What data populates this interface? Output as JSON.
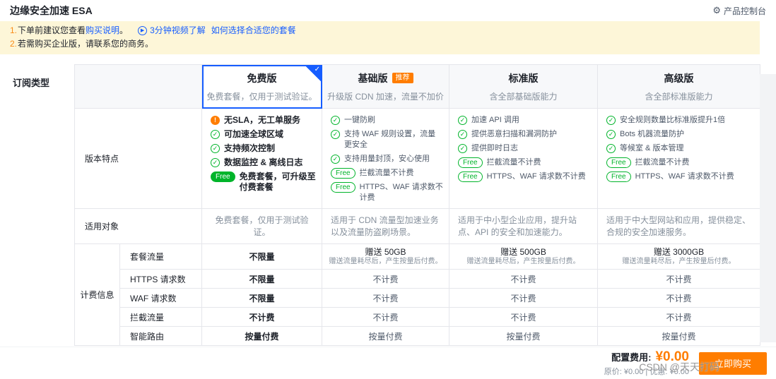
{
  "header": {
    "title": "边缘安全加速 ESA",
    "console_label": "产品控制台"
  },
  "icons": {
    "gear": "⚙",
    "play": "▶",
    "check": "✓",
    "warning": "!",
    "selected_check": "✓"
  },
  "labels": {
    "free": "Free"
  },
  "colors": {
    "accent_blue": "#165dff",
    "accent_orange": "#ff7d00",
    "success_green": "#00b42a",
    "notice_bg": "#fdf6d8"
  },
  "notice": {
    "line1_num": "1.",
    "line1_text": "下单前建议您查看",
    "line1_link": "购买说明",
    "line1_period": "。",
    "line1_video": "3分钟视频了解",
    "line1_video_link": "如何选择合适您的套餐",
    "line2_num": "2.",
    "line2_text": "若需购买企业版，请联系您的商务。"
  },
  "row_labels": {
    "subscription_type": "订阅类型",
    "features": "版本特点",
    "audience": "适用对象",
    "billing": "计费信息"
  },
  "billing_rows": [
    "套餐流量",
    "HTTPS 请求数",
    "WAF 请求数",
    "拦截流量",
    "智能路由"
  ],
  "plans": [
    {
      "name": "免费版",
      "subtitle": "免费套餐，仅用于测试验证。",
      "selected": true,
      "features": [
        {
          "icon": "warning-icon",
          "text": "无SLA，无工单服务"
        },
        {
          "icon": "check-icon",
          "text": "可加速全球区域"
        },
        {
          "icon": "check-icon",
          "text": "支持频次控制"
        },
        {
          "icon": "check-icon",
          "text": "数据监控 & 离线日志"
        },
        {
          "icon": "free-badge",
          "text": "免费套餐，可升级至付费套餐"
        }
      ],
      "audience": "免费套餐，仅用于测试验证。",
      "billing": {
        "traffic": "不限量",
        "https": "不限量",
        "waf": "不限量",
        "block": "不计费",
        "routing": "按量付费"
      }
    },
    {
      "name": "基础版",
      "badge": "推荐",
      "subtitle": "升级版 CDN 加速，流量不加价",
      "features": [
        {
          "icon": "check-icon",
          "text": "一键防刷"
        },
        {
          "icon": "check-icon",
          "text": "支持 WAF 规则设置，流量更安全"
        },
        {
          "icon": "check-icon",
          "text": "支持用量封顶，安心使用"
        },
        {
          "icon": "free-badge",
          "text": "拦截流量不计费"
        },
        {
          "icon": "free-badge",
          "text": "HTTPS、WAF 请求数不计费"
        }
      ],
      "audience": "适用于 CDN 流量型加速业务以及流量防盗刷场景。",
      "billing": {
        "traffic": "赠送 50GB",
        "traffic_note": "赠送流量耗尽后，产生按量后付费。",
        "https": "不计费",
        "waf": "不计费",
        "block": "不计费",
        "routing": "按量付费"
      }
    },
    {
      "name": "标准版",
      "subtitle": "含全部基础版能力",
      "features": [
        {
          "icon": "check-icon",
          "text": "加速 API 调用"
        },
        {
          "icon": "check-icon",
          "text": "提供恶意扫描和漏洞防护"
        },
        {
          "icon": "check-icon",
          "text": "提供即时日志"
        },
        {
          "icon": "free-badge",
          "text": "拦截流量不计费"
        },
        {
          "icon": "free-badge",
          "text": "HTTPS、WAF 请求数不计费"
        }
      ],
      "audience": "适用于中小型企业应用，提升站点、API 的安全和加速能力。",
      "billing": {
        "traffic": "赠送 500GB",
        "traffic_note": "赠送流量耗尽后，产生按量后付费。",
        "https": "不计费",
        "waf": "不计费",
        "block": "不计费",
        "routing": "按量付费"
      }
    },
    {
      "name": "高级版",
      "subtitle": "含全部标准版能力",
      "features": [
        {
          "icon": "check-icon",
          "text": "安全规则数量比标准版提升1倍"
        },
        {
          "icon": "check-icon",
          "text": "Bots 机器流量防护"
        },
        {
          "icon": "check-icon",
          "text": "等候室 & 版本管理"
        },
        {
          "icon": "free-badge",
          "text": "拦截流量不计费"
        },
        {
          "icon": "free-badge",
          "text": "HTTPS、WAF 请求数不计费"
        }
      ],
      "audience": "适用于中大型网站和应用，提供稳定、合规的安全加速服务。",
      "billing": {
        "traffic": "赠送 3000GB",
        "traffic_note": "赠送流量耗尽后，产生按量后付费。",
        "https": "不计费",
        "waf": "不计费",
        "block": "不计费",
        "routing": "按量付费"
      }
    }
  ],
  "footer": {
    "fee_label": "配置费用:",
    "fee_value": "¥0.00",
    "fee_detail": "原价: ¥0.00 | 优惠: ¥0.00",
    "buy_label": "立即购买",
    "watermark": "CSDN @天天打码"
  }
}
